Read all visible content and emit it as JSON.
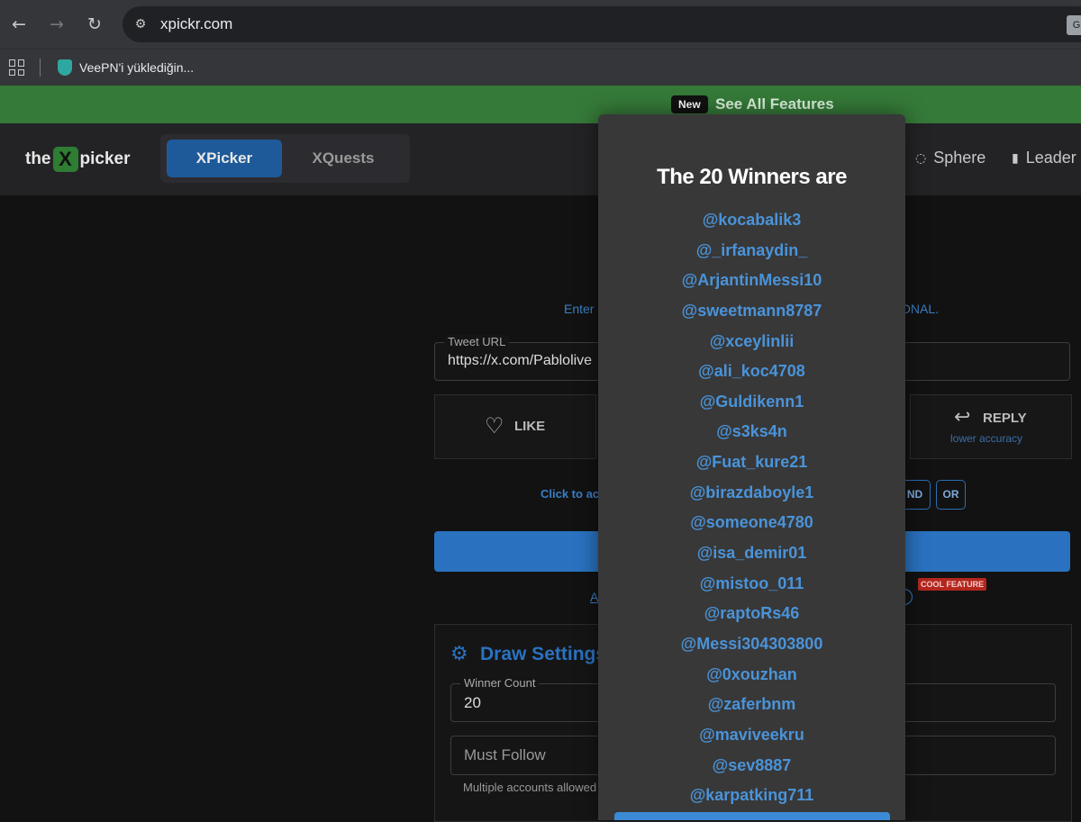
{
  "browser": {
    "url": "xpickr.com",
    "bookmark_label": "VeePN'i yüklediğin..."
  },
  "banner": {
    "badge": "New",
    "link": "See All Features"
  },
  "header": {
    "logo_the": "the",
    "logo_x": "X",
    "logo_picker": "picker",
    "tab_xpicker": "XPicker",
    "tab_xquests": "XQuests",
    "nav_sphere": "Sphere",
    "nav_leader": "Leader"
  },
  "form": {
    "enter_text": "Enter",
    "optional_text": "ONAL.",
    "tweet_url_label": "Tweet URL",
    "tweet_url_value": "https://x.com/Pablolive",
    "like_label": "LIKE",
    "reply_label": "REPLY",
    "reply_sub": "lower accuracy",
    "click_text": "Click to act",
    "and_label": "ND",
    "or_label": "OR",
    "a_link": "A",
    "cool_feature": "COOL FEATURE"
  },
  "settings": {
    "title": "Draw Settings",
    "winner_count_label": "Winner Count",
    "winner_count_value": "20",
    "must_follow_placeholder": "Must Follow",
    "multiple_text": "Multiple accounts allowed"
  },
  "modal": {
    "title": "The 20 Winners are",
    "winners": [
      "@kocabalik3",
      "@_irfanaydin_",
      "@ArjantinMessi10",
      "@sweetmann8787",
      "@xceylinlii",
      "@ali_koc4708",
      "@Guldikenn1",
      "@s3ks4n",
      "@Fuat_kure21",
      "@birazdaboyle1",
      "@someone4780",
      "@isa_demir01",
      "@mistoo_011",
      "@raptoRs46",
      "@Messi304303800",
      "@0xouzhan",
      "@zaferbnm",
      "@maviveekru",
      "@sev8887",
      "@karpatking711"
    ]
  },
  "colors": {
    "banner_green": "#357a38",
    "accent_blue": "#2a72c0",
    "winner_blue": "#4a93d9"
  }
}
